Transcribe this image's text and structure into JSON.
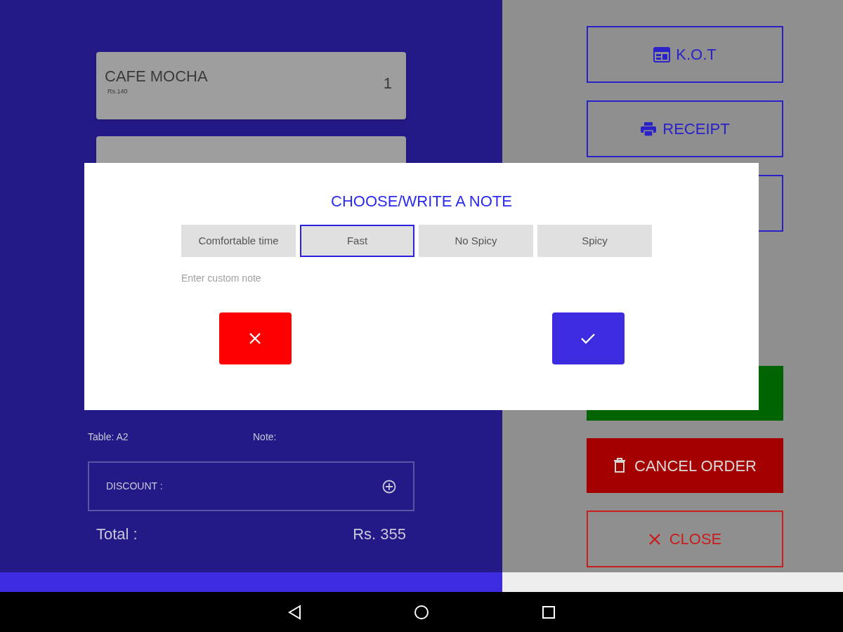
{
  "order": {
    "items": [
      {
        "kind": "item",
        "name": "CAFE MOCHA",
        "price": "Rs.140",
        "qty": "1"
      },
      {
        "kind": "covered"
      }
    ],
    "table": "Table: A2",
    "note": "Note:",
    "discount": {
      "label": "DISCOUNT :"
    },
    "total": {
      "label": "Total :",
      "value": "Rs. 355"
    }
  },
  "actions": [
    {
      "kind": "kot",
      "label": "K.O.T"
    },
    {
      "kind": "receipt",
      "label": "RECEIPT"
    },
    {
      "kind": "blank"
    },
    {
      "kind": "green"
    },
    {
      "kind": "cancel",
      "label": "CANCEL ORDER"
    },
    {
      "kind": "close",
      "label": "CLOSE"
    }
  ],
  "dialog": {
    "title": "CHOOSE/WRITE A NOTE",
    "chips": [
      {
        "label": "Comfortable time",
        "selected": false
      },
      {
        "label": "Fast",
        "selected": true
      },
      {
        "label": "No Spicy",
        "selected": false
      },
      {
        "label": "Spicy",
        "selected": false
      }
    ],
    "custom_note": {
      "placeholder": "Enter custom note"
    },
    "buttons": [
      {
        "kind": "reject"
      },
      {
        "kind": "accept"
      }
    ]
  }
}
